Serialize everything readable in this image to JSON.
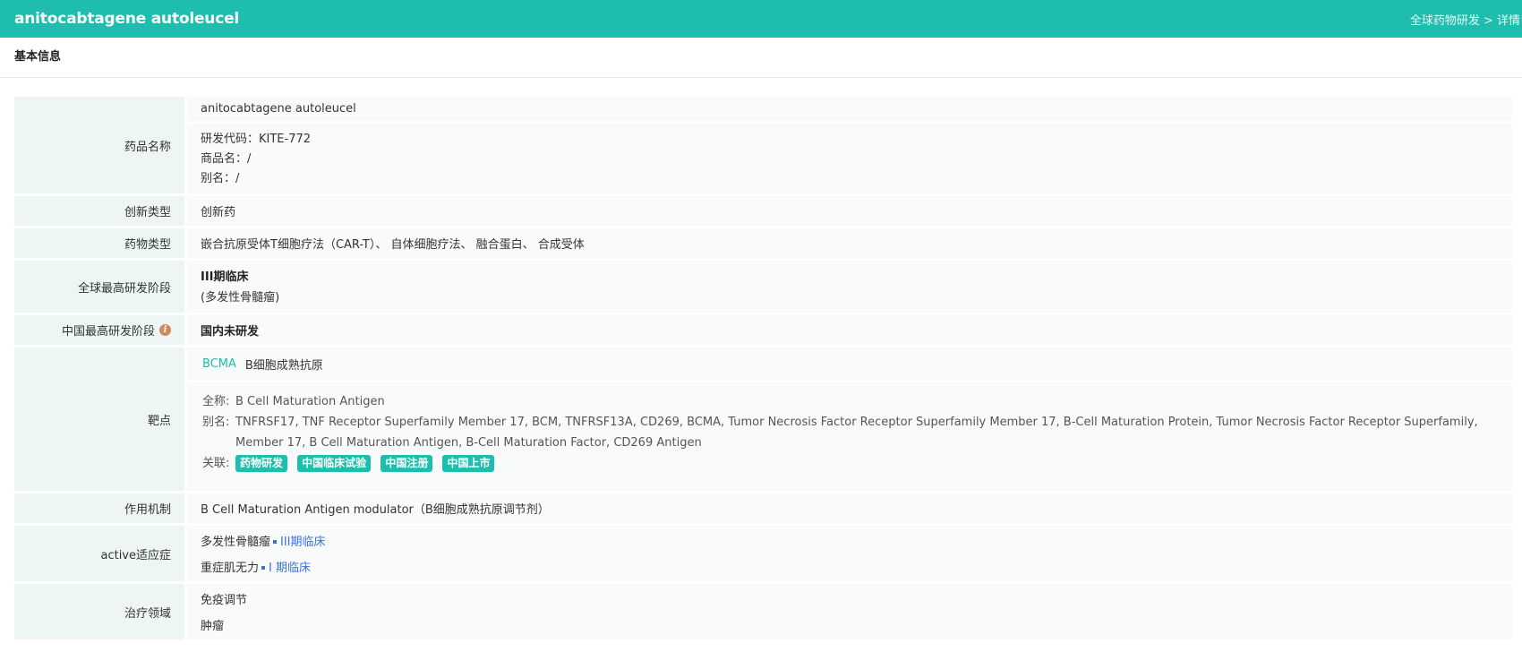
{
  "header": {
    "title": "anitocabtagene autoleucel",
    "breadcrumb": "全球药物研发 > 详情"
  },
  "section": {
    "title": "基本信息"
  },
  "rows": {
    "drug_name": {
      "label": "药品名称",
      "name": "anitocabtagene autoleucel",
      "code": "研发代码：KITE-772",
      "trade": "商品名：/",
      "alias": "别名：/"
    },
    "innovation": {
      "label": "创新类型",
      "value": "创新药"
    },
    "drug_type": {
      "label": "药物类型",
      "value": "嵌合抗原受体T细胞疗法（CAR-T）、 自体细胞疗法、 融合蛋白、 合成受体"
    },
    "global_stage": {
      "label": "全球最高研发阶段",
      "value": "III期临床",
      "note": "(多发性骨髓瘤)"
    },
    "china_stage": {
      "label": "中国最高研发阶段",
      "value": "国内未研发"
    },
    "target": {
      "label": "靶点",
      "link": "BCMA",
      "name": "B细胞成熟抗原",
      "fullname_label": "全称:",
      "fullname": "B Cell Maturation Antigen",
      "alias_label": "别名:",
      "alias": "TNFRSF17, TNF Receptor Superfamily Member 17, BCM, TNFRSF13A, CD269, BCMA, Tumor Necrosis Factor Receptor Superfamily Member 17, B-Cell Maturation Protein, Tumor Necrosis Factor Receptor Superfamily, Member 17, B Cell Maturation Antigen, B-Cell Maturation Factor, CD269 Antigen",
      "related_label": "关联:",
      "tags": [
        "药物研发",
        "中国临床试验",
        "中国注册",
        "中国上市"
      ]
    },
    "mechanism": {
      "label": "作用机制",
      "value": "B Cell Maturation Antigen modulator（B细胞成熟抗原调节剂）"
    },
    "indication": {
      "label": "active适应症",
      "items": [
        {
          "name": "多发性骨髓瘤",
          "phase": "III期临床"
        },
        {
          "name": "重症肌无力",
          "phase": "I 期临床"
        }
      ]
    },
    "therapy": {
      "label": "治疗领域",
      "items": [
        "免疫调节",
        "肿瘤"
      ]
    }
  },
  "colors": {
    "brand": "#1ebdad",
    "label_bg": "#eef5f5",
    "phase": "#3a73d6"
  }
}
